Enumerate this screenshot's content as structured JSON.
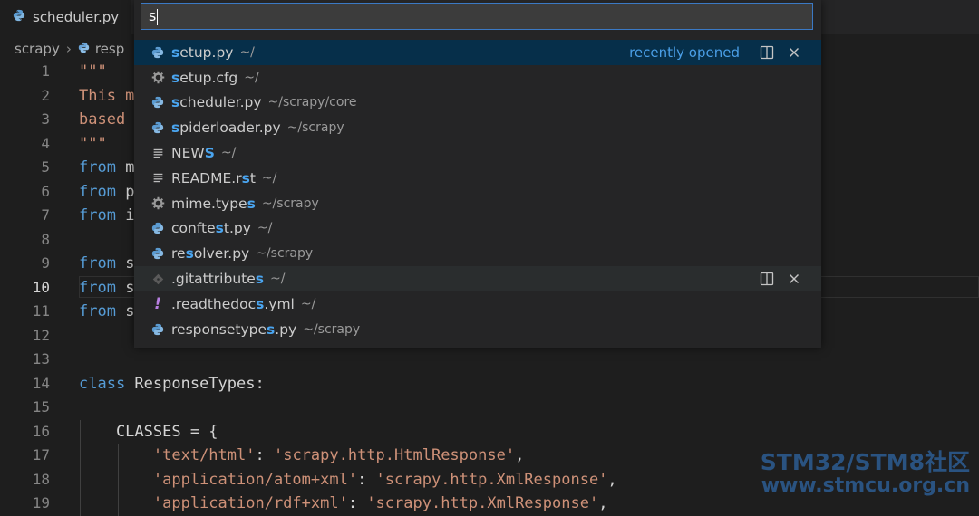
{
  "tab": {
    "label": "scheduler.py"
  },
  "breadcrumb": {
    "root": "scrapy",
    "file": "resp"
  },
  "picker": {
    "query": "s",
    "recently_opened_label": "recently opened",
    "items": [
      {
        "icon": "python-icon",
        "pre": "",
        "hl": "s",
        "post": "etup.py",
        "path": "~/"
      },
      {
        "icon": "gear-icon",
        "pre": "",
        "hl": "s",
        "post": "etup.cfg",
        "path": "~/"
      },
      {
        "icon": "python-icon",
        "pre": "",
        "hl": "s",
        "post": "cheduler.py",
        "path": "~/scrapy/core"
      },
      {
        "icon": "python-icon",
        "pre": "",
        "hl": "s",
        "post": "piderloader.py",
        "path": "~/scrapy"
      },
      {
        "icon": "lines-icon",
        "pre": "NEW",
        "hl": "S",
        "post": "",
        "path": "~/"
      },
      {
        "icon": "lines-icon",
        "pre": "README.r",
        "hl": "s",
        "post": "t",
        "path": "~/"
      },
      {
        "icon": "gear-icon",
        "pre": "mime.type",
        "hl": "s",
        "post": "",
        "path": "~/scrapy"
      },
      {
        "icon": "python-icon",
        "pre": "confte",
        "hl": "s",
        "post": "t.py",
        "path": "~/"
      },
      {
        "icon": "python-icon",
        "pre": "re",
        "hl": "s",
        "post": "olver.py",
        "path": "~/scrapy"
      },
      {
        "icon": "git-icon",
        "pre": ".gitattribute",
        "hl": "s",
        "post": "",
        "path": "~/"
      },
      {
        "icon": "exclamation-icon",
        "pre": ".readthedoc",
        "hl": "s",
        "post": ".yml",
        "path": "~/"
      },
      {
        "icon": "python-icon",
        "pre": "responsetype",
        "hl": "s",
        "post": ".py",
        "path": "~/scrapy"
      }
    ]
  },
  "editor": {
    "line_numbers": [
      "1",
      "2",
      "3",
      "4",
      "5",
      "6",
      "7",
      "8",
      "9",
      "10",
      "11",
      "12",
      "13",
      "14",
      "15",
      "16",
      "17",
      "18",
      "19"
    ],
    "current_line": "10",
    "lines": [
      {
        "parts": [
          {
            "t": "\"\"\"",
            "c": "str"
          }
        ]
      },
      {
        "parts": [
          {
            "t": "This m",
            "c": "str"
          }
        ]
      },
      {
        "parts": [
          {
            "t": "based ",
            "c": "str"
          }
        ]
      },
      {
        "parts": [
          {
            "t": "\"\"\"",
            "c": "str"
          }
        ]
      },
      {
        "parts": [
          {
            "t": "from",
            "c": "kw"
          },
          {
            "t": " m",
            "c": "txt"
          }
        ]
      },
      {
        "parts": [
          {
            "t": "from",
            "c": "kw"
          },
          {
            "t": " p",
            "c": "txt"
          }
        ]
      },
      {
        "parts": [
          {
            "t": "from",
            "c": "kw"
          },
          {
            "t": " i",
            "c": "txt"
          }
        ]
      },
      {
        "parts": []
      },
      {
        "parts": [
          {
            "t": "from",
            "c": "kw"
          },
          {
            "t": " s",
            "c": "txt"
          }
        ]
      },
      {
        "parts": [
          {
            "t": "from",
            "c": "kw"
          },
          {
            "t": " s",
            "c": "txt"
          }
        ]
      },
      {
        "parts": [
          {
            "t": "from",
            "c": "kw"
          },
          {
            "t": " s",
            "c": "txt"
          }
        ]
      },
      {
        "parts": []
      },
      {
        "parts": []
      },
      {
        "parts": [
          {
            "t": "class",
            "c": "kw"
          },
          {
            "t": " ResponseTypes:",
            "c": "cls"
          }
        ]
      },
      {
        "parts": []
      },
      {
        "parts": [
          {
            "t": "    CLASSES = {",
            "c": "txt"
          }
        ]
      },
      {
        "parts": [
          {
            "t": "        ",
            "c": "txt"
          },
          {
            "t": "'text/html'",
            "c": "str"
          },
          {
            "t": ": ",
            "c": "txt"
          },
          {
            "t": "'scrapy.http.HtmlResponse'",
            "c": "str"
          },
          {
            "t": ",",
            "c": "txt"
          }
        ]
      },
      {
        "parts": [
          {
            "t": "        ",
            "c": "txt"
          },
          {
            "t": "'application/atom+xml'",
            "c": "str"
          },
          {
            "t": ": ",
            "c": "txt"
          },
          {
            "t": "'scrapy.http.XmlResponse'",
            "c": "str"
          },
          {
            "t": ",",
            "c": "txt"
          }
        ]
      },
      {
        "parts": [
          {
            "t": "        ",
            "c": "txt"
          },
          {
            "t": "'application/rdf+xml'",
            "c": "str"
          },
          {
            "t": ": ",
            "c": "txt"
          },
          {
            "t": "'scrapy.http.XmlResponse'",
            "c": "str"
          },
          {
            "t": ",",
            "c": "txt"
          }
        ]
      }
    ]
  },
  "watermark": {
    "line1": "STM32/STM8社区",
    "line2": "www.stmcu.org.cn"
  },
  "colors": {
    "accent": "#4aa5f0",
    "selection": "#062f4a",
    "keyword": "#569cd6",
    "string": "#ce9178"
  }
}
